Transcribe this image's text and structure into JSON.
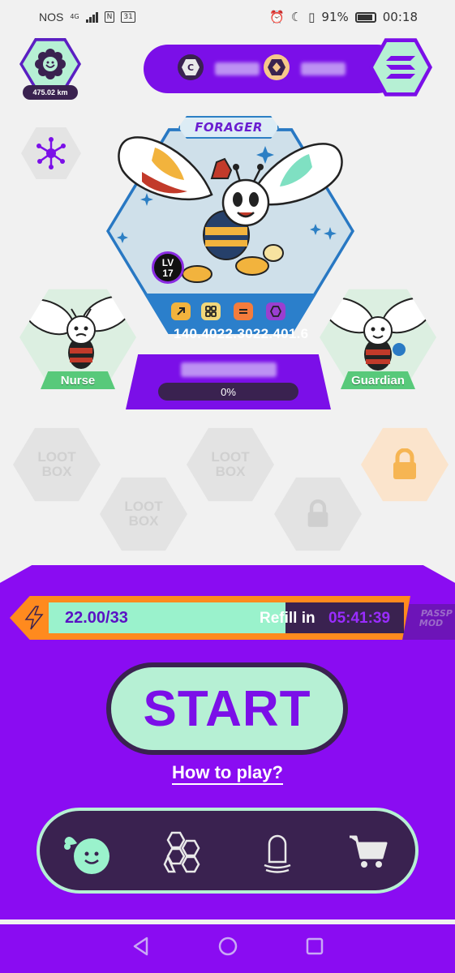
{
  "status_bar": {
    "carrier": "NOS",
    "network": "4G",
    "nfc": "N",
    "calendar_day": "31",
    "battery": "91%",
    "time": "00:18",
    "icons": [
      "alarm-icon",
      "moon-icon",
      "vibrate-icon",
      "battery-icon"
    ]
  },
  "profile": {
    "distance": "475.02 km",
    "avatar_icon": "flower-smiley-icon"
  },
  "wallet": {
    "token1_icon": "coin-c-icon",
    "token2_icon": "coin-gem-icon",
    "chain_icon": "solana-icon"
  },
  "network_button": {
    "icon": "network-nodes-icon"
  },
  "main_card": {
    "class_label": "FORAGER",
    "level_prefix": "LV",
    "level": "17",
    "stats": "140.4022.3022.401.6",
    "progress_label": "0%",
    "progress": 0,
    "abilities": [
      {
        "icon": "arrow-icon",
        "color": "#f2b33d"
      },
      {
        "icon": "grid-icon",
        "color": "#f1d77a"
      },
      {
        "icon": "equals-icon",
        "color": "#f47c3c"
      },
      {
        "icon": "hexagon-icon",
        "color": "#9a3fd0"
      }
    ]
  },
  "side_cards": [
    {
      "label": "Nurse"
    },
    {
      "label": "Guardian"
    }
  ],
  "lootboxes": {
    "label_line1": "LOOT",
    "label_line2": "BOX"
  },
  "energy": {
    "value": "22.00/33",
    "fill": 0.6667,
    "refill_label": "Refill in",
    "refill_time": "05:41:39",
    "passport_label_line1": "PASSP",
    "passport_label_line2": "MOD"
  },
  "start": {
    "label": "START"
  },
  "how_to_play": "How to play?",
  "bottom_nav": [
    {
      "icon": "bee-bomb-icon"
    },
    {
      "icon": "hexagons-icon"
    },
    {
      "icon": "capsule-icon"
    },
    {
      "icon": "cart-icon"
    }
  ],
  "colors": {
    "primary_purple": "#7b0fe8",
    "mint": "#b6f0d4",
    "dark": "#3a2250",
    "orange": "#ff8a1e"
  }
}
